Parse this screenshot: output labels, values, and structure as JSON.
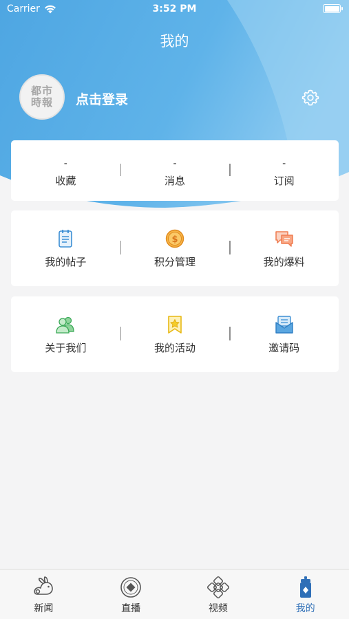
{
  "status_bar": {
    "carrier": "Carrier",
    "time": "3:52 PM"
  },
  "header": {
    "title": "我的"
  },
  "profile": {
    "avatar_text_line1": "都市",
    "avatar_text_line2": "時報",
    "login_label": "点击登录"
  },
  "stats": [
    {
      "value": "-",
      "label": "收藏"
    },
    {
      "value": "-",
      "label": "消息"
    },
    {
      "value": "-",
      "label": "订阅"
    }
  ],
  "menu_row1": [
    {
      "label": "我的帖子",
      "icon": "notebook-icon"
    },
    {
      "label": "积分管理",
      "icon": "coin-icon"
    },
    {
      "label": "我的爆料",
      "icon": "chat-bubbles-icon"
    }
  ],
  "menu_row2": [
    {
      "label": "关于我们",
      "icon": "users-icon"
    },
    {
      "label": "我的活动",
      "icon": "star-bookmark-icon"
    },
    {
      "label": "邀请码",
      "icon": "envelope-icon"
    }
  ],
  "tabbar": [
    {
      "label": "新闻",
      "icon": "rabbit-icon",
      "active": false
    },
    {
      "label": "直播",
      "icon": "live-icon",
      "active": false
    },
    {
      "label": "视频",
      "icon": "knot-icon",
      "active": false
    },
    {
      "label": "我的",
      "icon": "profile-tab-icon",
      "active": true
    }
  ],
  "colors": {
    "header_blue": "#5aaee6",
    "header_blue_dark": "#3e95d6",
    "active_tab": "#2f6fb7",
    "background": "#f4f4f5"
  }
}
